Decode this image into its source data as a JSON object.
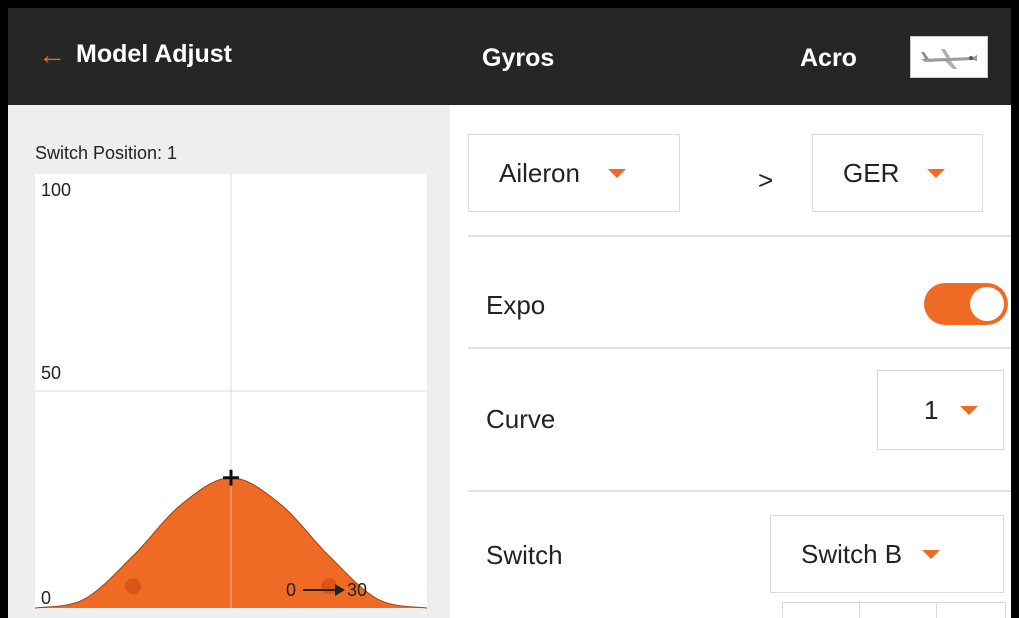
{
  "header": {
    "back_label": "Model Adjust",
    "screen_title": "Gyros",
    "model_name": "Acro",
    "back_icon": "back-arrow-icon",
    "model_thumbnail_icon": "airplane-icon"
  },
  "graph_panel": {
    "switch_position_label": "Switch Position: 1",
    "y_tick_100": "100",
    "y_tick_50": "50",
    "y_tick_0": "0",
    "range_from": "0",
    "range_to": "30"
  },
  "channel_mapping": {
    "source_value": "Aileron",
    "separator": ">",
    "target_value": "GER"
  },
  "expo": {
    "label": "Expo",
    "enabled": true
  },
  "curve": {
    "label": "Curve",
    "value": "1"
  },
  "switch": {
    "label": "Switch",
    "value": "Switch B"
  },
  "colors": {
    "accent": "#ef6b25",
    "header_bg": "#262626",
    "graph_bg": "#eeeeee"
  },
  "chart_data": {
    "type": "area",
    "x": [
      -100,
      -75,
      -50,
      -25,
      0,
      25,
      50,
      75,
      100
    ],
    "values": [
      0,
      2,
      12,
      24,
      30,
      24,
      12,
      2,
      0
    ],
    "ylim": [
      0,
      100
    ],
    "xlim": [
      -100,
      100
    ],
    "grid": true,
    "handle_points": [
      {
        "x": -50,
        "y": 5
      },
      {
        "x": 0,
        "y": 30
      },
      {
        "x": 50,
        "y": 5
      }
    ]
  }
}
